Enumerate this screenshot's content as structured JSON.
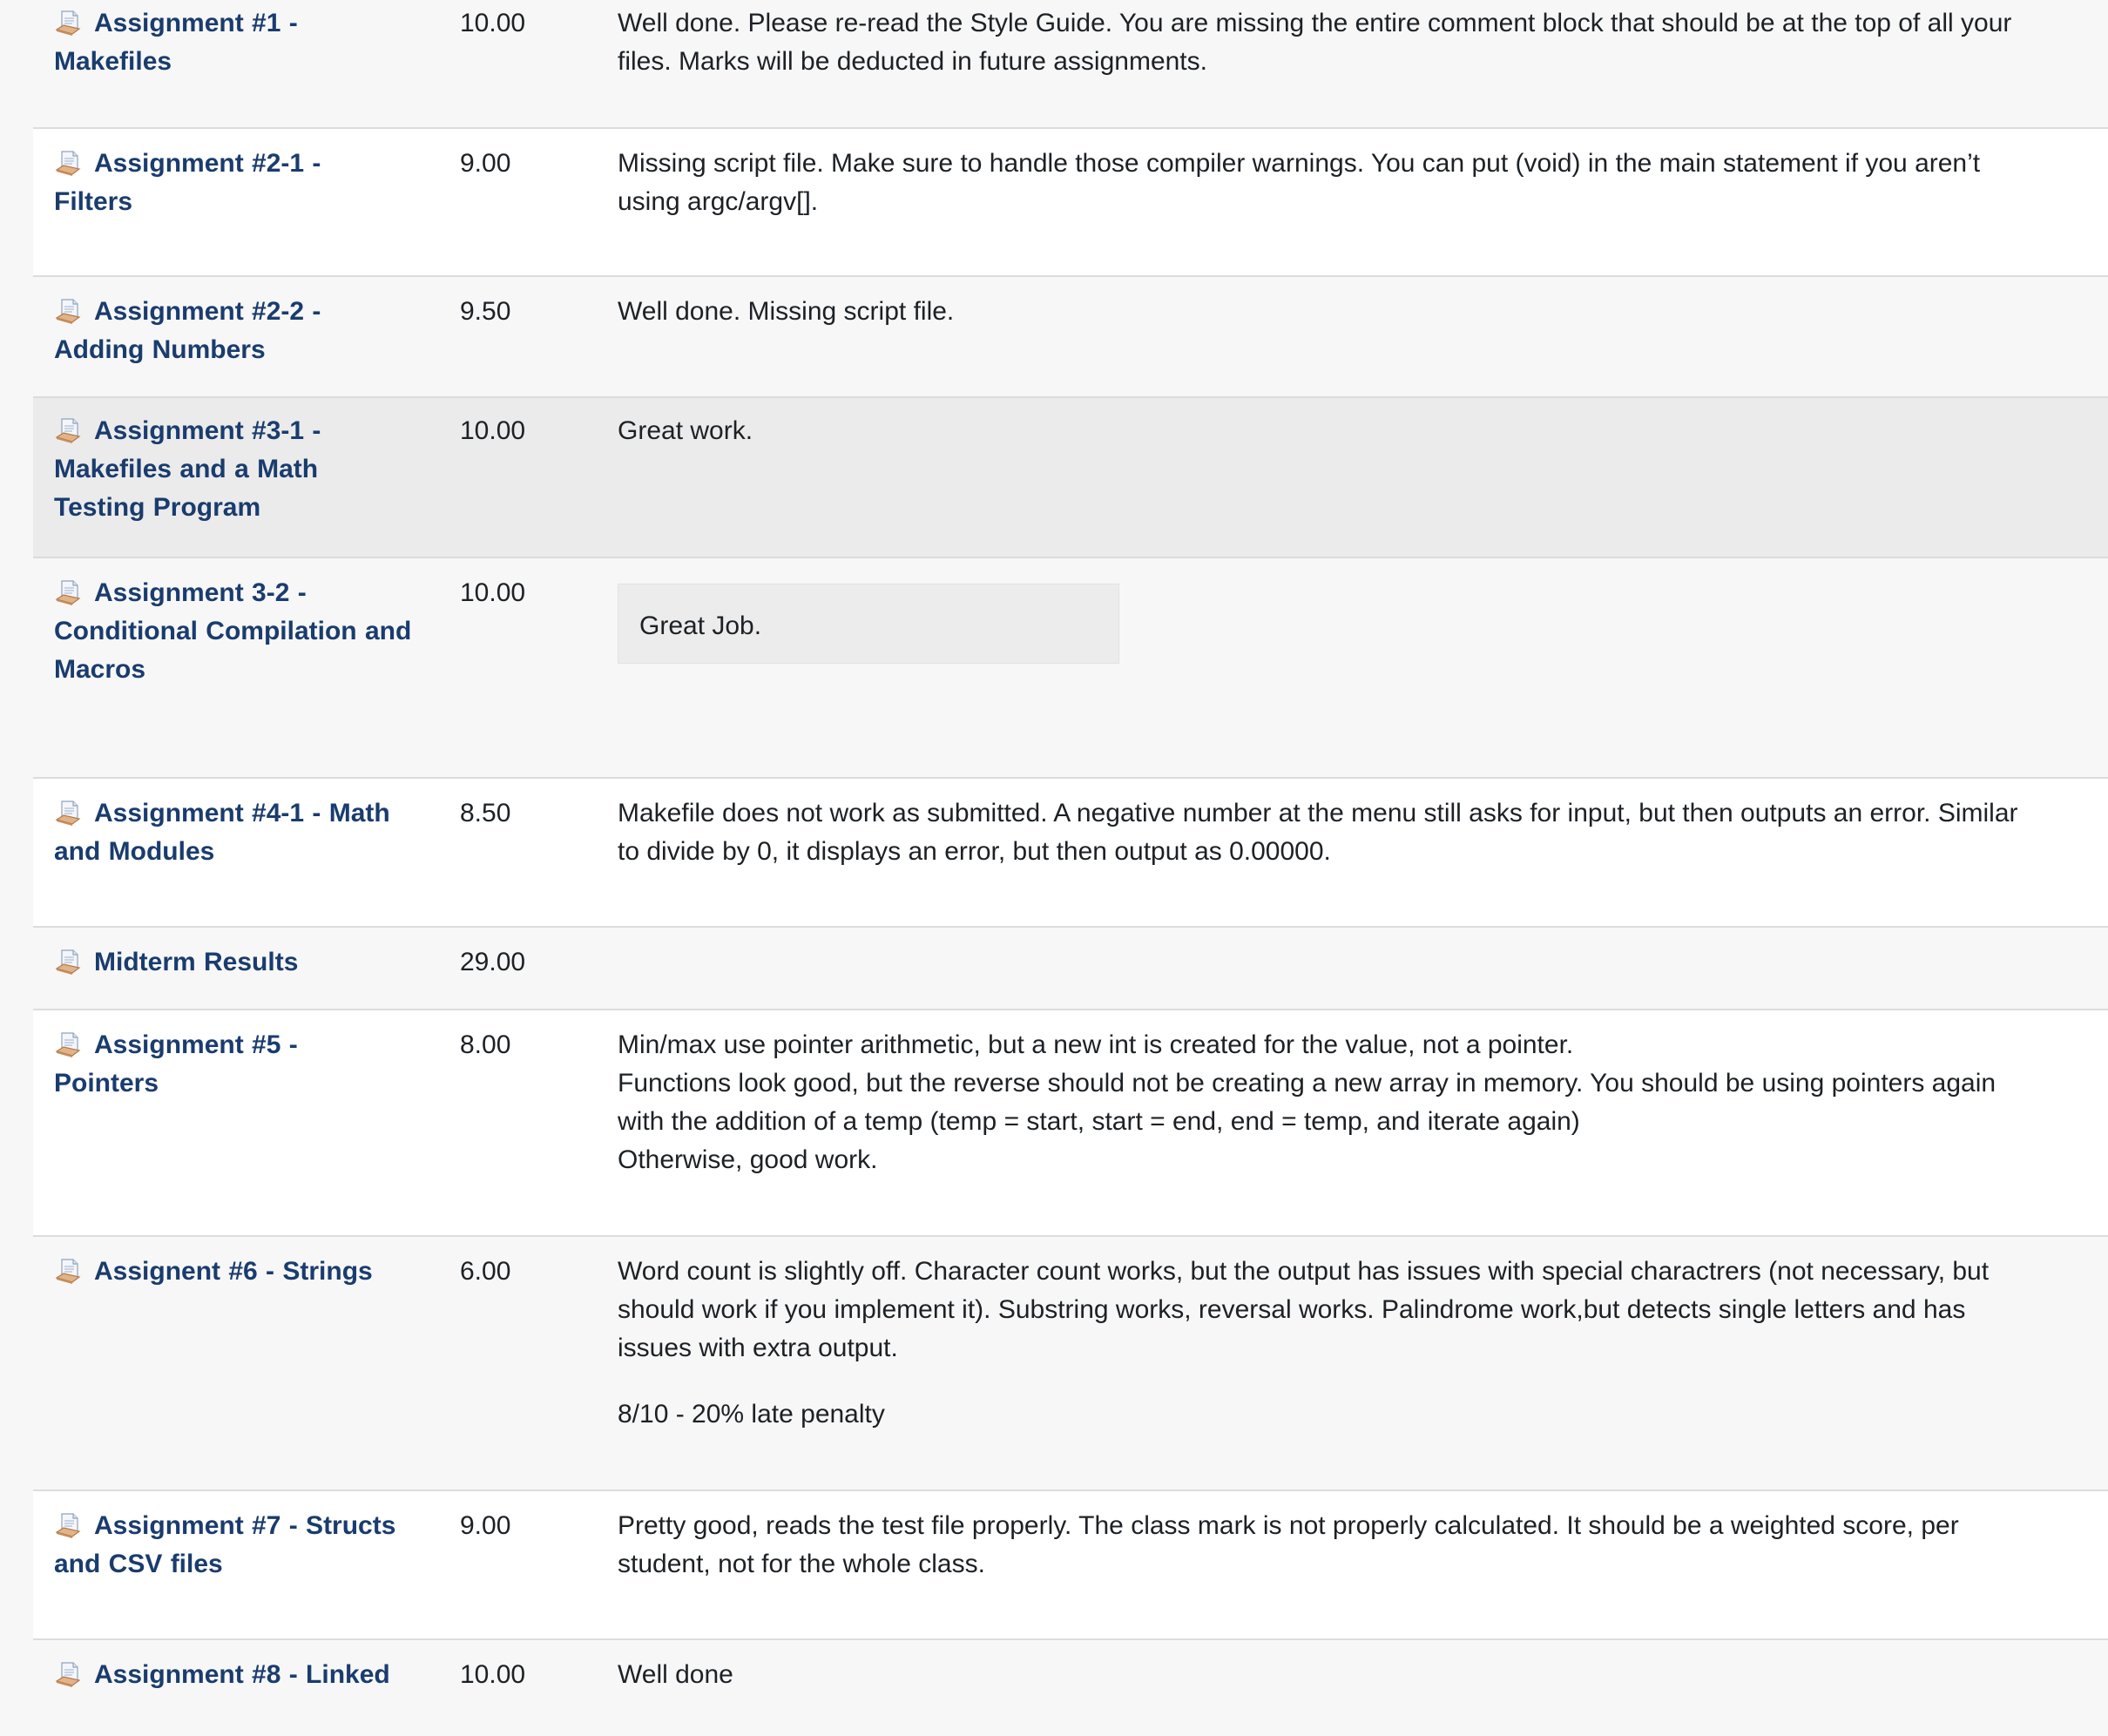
{
  "rows": [
    {
      "name": "Assignment #1 - Makefiles",
      "name_lines": [
        "Assignment #1 -",
        "Makefiles"
      ],
      "grade": "10.00",
      "feedback": [
        "Well done.  Please re-read the Style Guide.  You are missing the entire comment block that should be at the top of all your",
        "files.  Marks will be deducted in future assignments."
      ]
    },
    {
      "name": "Assignment #2-1 - Filters",
      "name_lines": [
        "Assignment #2-1 -",
        "Filters"
      ],
      "grade": "9.00",
      "feedback": [
        "Missing script file. Make sure to handle those compiler warnings.  You can put (void) in the main statement if you aren’t",
        "using argc/argv[]."
      ]
    },
    {
      "name": "Assignment #2-2 - Adding Numbers",
      "name_lines": [
        "Assignment #2-2 -",
        "Adding Numbers"
      ],
      "grade": "9.50",
      "feedback": [
        "Well done.  Missing script file."
      ]
    },
    {
      "name": "Assignment #3-1 - Makefiles and a Math Testing Program",
      "name_lines": [
        "Assignment #3-1 -",
        "Makefiles and a Math",
        "Testing Program"
      ],
      "grade": "10.00",
      "feedback": [
        "Great work."
      ]
    },
    {
      "name": "Assignment 3-2 - Conditional Compilation and Macros",
      "name_lines": [
        "Assignment 3-2 -",
        "Conditional Compilation and",
        "Macros"
      ],
      "grade": "10.00",
      "feedback_box": "Great Job."
    },
    {
      "name": "Assignment #4-1 - Math and Modules",
      "name_lines": [
        "Assignment #4-1 - Math",
        "and Modules"
      ],
      "grade": "8.50",
      "feedback": [
        "Makefile does not work as submitted. A negative number at the menu still asks for input, but then outputs an error. Similar",
        "to divide by 0, it displays an error, but then output as 0.00000."
      ]
    },
    {
      "name": "Midterm Results",
      "name_lines": [
        "Midterm Results"
      ],
      "grade": "29.00",
      "feedback": []
    },
    {
      "name": "Assignment #5 - Pointers",
      "name_lines": [
        "Assignment #5 -",
        "Pointers"
      ],
      "grade": "8.00",
      "feedback": [
        "Min/max use pointer arithmetic, but a new int is created for the value, not a pointer.",
        "Functions look good, but the reverse should not be creating a new array in memory.  You should be using pointers again",
        "with the addition of a temp (temp = start, start = end, end = temp, and iterate again)",
        "Otherwise, good work."
      ]
    },
    {
      "name": "Assignent #6 - Strings",
      "name_lines": [
        "Assignent #6 - Strings"
      ],
      "grade": "6.00",
      "feedback": [
        "Word count is slightly off.  Character count works, but the output has issues with special charactrers (not necessary, but",
        "should work if you implement it).  Substring works, reversal works.  Palindrome work,but detects single letters and has",
        "issues with extra output."
      ],
      "feedback_extra": "8/10 - 20% late penalty"
    },
    {
      "name": "Assignment #7 - Structs and CSV files",
      "name_lines": [
        "Assignment #7 - Structs",
        "and CSV files"
      ],
      "grade": "9.00",
      "feedback": [
        "Pretty good, reads the test file properly. The class mark is not properly calculated.  It should be a weighted score, per",
        "student, not for the whole class."
      ]
    },
    {
      "name": "Assignment #8 - Linked",
      "name_lines": [
        "Assignment #8 - Linked"
      ],
      "grade": "10.00",
      "feedback": [
        "Well done"
      ]
    }
  ],
  "icon": "assignment-icon",
  "colors": {
    "link": "#1a3c6e",
    "row_alt": "#f7f7f7",
    "row_white": "#ffffff",
    "row_highlight": "#ebebeb",
    "divider": "#dcdcdc"
  }
}
